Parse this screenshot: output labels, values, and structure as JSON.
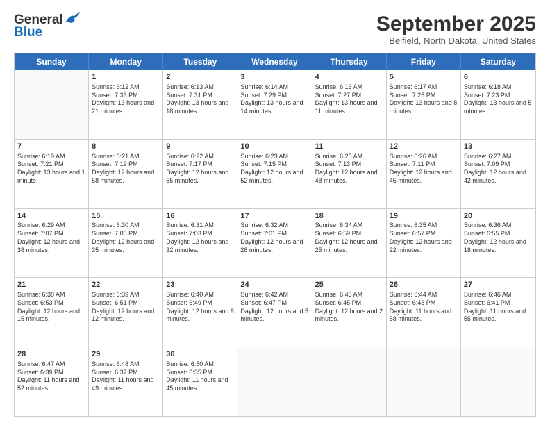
{
  "logo": {
    "general": "General",
    "blue": "Blue"
  },
  "header": {
    "month": "September 2025",
    "location": "Belfield, North Dakota, United States"
  },
  "weekdays": [
    "Sunday",
    "Monday",
    "Tuesday",
    "Wednesday",
    "Thursday",
    "Friday",
    "Saturday"
  ],
  "weeks": [
    [
      {
        "day": "",
        "sunrise": "",
        "sunset": "",
        "daylight": ""
      },
      {
        "day": "1",
        "sunrise": "Sunrise: 6:12 AM",
        "sunset": "Sunset: 7:33 PM",
        "daylight": "Daylight: 13 hours and 21 minutes."
      },
      {
        "day": "2",
        "sunrise": "Sunrise: 6:13 AM",
        "sunset": "Sunset: 7:31 PM",
        "daylight": "Daylight: 13 hours and 18 minutes."
      },
      {
        "day": "3",
        "sunrise": "Sunrise: 6:14 AM",
        "sunset": "Sunset: 7:29 PM",
        "daylight": "Daylight: 13 hours and 14 minutes."
      },
      {
        "day": "4",
        "sunrise": "Sunrise: 6:16 AM",
        "sunset": "Sunset: 7:27 PM",
        "daylight": "Daylight: 13 hours and 11 minutes."
      },
      {
        "day": "5",
        "sunrise": "Sunrise: 6:17 AM",
        "sunset": "Sunset: 7:25 PM",
        "daylight": "Daylight: 13 hours and 8 minutes."
      },
      {
        "day": "6",
        "sunrise": "Sunrise: 6:18 AM",
        "sunset": "Sunset: 7:23 PM",
        "daylight": "Daylight: 13 hours and 5 minutes."
      }
    ],
    [
      {
        "day": "7",
        "sunrise": "Sunrise: 6:19 AM",
        "sunset": "Sunset: 7:21 PM",
        "daylight": "Daylight: 13 hours and 1 minute."
      },
      {
        "day": "8",
        "sunrise": "Sunrise: 6:21 AM",
        "sunset": "Sunset: 7:19 PM",
        "daylight": "Daylight: 12 hours and 58 minutes."
      },
      {
        "day": "9",
        "sunrise": "Sunrise: 6:22 AM",
        "sunset": "Sunset: 7:17 PM",
        "daylight": "Daylight: 12 hours and 55 minutes."
      },
      {
        "day": "10",
        "sunrise": "Sunrise: 6:23 AM",
        "sunset": "Sunset: 7:15 PM",
        "daylight": "Daylight: 12 hours and 52 minutes."
      },
      {
        "day": "11",
        "sunrise": "Sunrise: 6:25 AM",
        "sunset": "Sunset: 7:13 PM",
        "daylight": "Daylight: 12 hours and 48 minutes."
      },
      {
        "day": "12",
        "sunrise": "Sunrise: 6:26 AM",
        "sunset": "Sunset: 7:11 PM",
        "daylight": "Daylight: 12 hours and 45 minutes."
      },
      {
        "day": "13",
        "sunrise": "Sunrise: 6:27 AM",
        "sunset": "Sunset: 7:09 PM",
        "daylight": "Daylight: 12 hours and 42 minutes."
      }
    ],
    [
      {
        "day": "14",
        "sunrise": "Sunrise: 6:29 AM",
        "sunset": "Sunset: 7:07 PM",
        "daylight": "Daylight: 12 hours and 38 minutes."
      },
      {
        "day": "15",
        "sunrise": "Sunrise: 6:30 AM",
        "sunset": "Sunset: 7:05 PM",
        "daylight": "Daylight: 12 hours and 35 minutes."
      },
      {
        "day": "16",
        "sunrise": "Sunrise: 6:31 AM",
        "sunset": "Sunset: 7:03 PM",
        "daylight": "Daylight: 12 hours and 32 minutes."
      },
      {
        "day": "17",
        "sunrise": "Sunrise: 6:32 AM",
        "sunset": "Sunset: 7:01 PM",
        "daylight": "Daylight: 12 hours and 28 minutes."
      },
      {
        "day": "18",
        "sunrise": "Sunrise: 6:34 AM",
        "sunset": "Sunset: 6:59 PM",
        "daylight": "Daylight: 12 hours and 25 minutes."
      },
      {
        "day": "19",
        "sunrise": "Sunrise: 6:35 AM",
        "sunset": "Sunset: 6:57 PM",
        "daylight": "Daylight: 12 hours and 22 minutes."
      },
      {
        "day": "20",
        "sunrise": "Sunrise: 6:36 AM",
        "sunset": "Sunset: 6:55 PM",
        "daylight": "Daylight: 12 hours and 18 minutes."
      }
    ],
    [
      {
        "day": "21",
        "sunrise": "Sunrise: 6:38 AM",
        "sunset": "Sunset: 6:53 PM",
        "daylight": "Daylight: 12 hours and 15 minutes."
      },
      {
        "day": "22",
        "sunrise": "Sunrise: 6:39 AM",
        "sunset": "Sunset: 6:51 PM",
        "daylight": "Daylight: 12 hours and 12 minutes."
      },
      {
        "day": "23",
        "sunrise": "Sunrise: 6:40 AM",
        "sunset": "Sunset: 6:49 PM",
        "daylight": "Daylight: 12 hours and 8 minutes."
      },
      {
        "day": "24",
        "sunrise": "Sunrise: 6:42 AM",
        "sunset": "Sunset: 6:47 PM",
        "daylight": "Daylight: 12 hours and 5 minutes."
      },
      {
        "day": "25",
        "sunrise": "Sunrise: 6:43 AM",
        "sunset": "Sunset: 6:45 PM",
        "daylight": "Daylight: 12 hours and 2 minutes."
      },
      {
        "day": "26",
        "sunrise": "Sunrise: 6:44 AM",
        "sunset": "Sunset: 6:43 PM",
        "daylight": "Daylight: 11 hours and 58 minutes."
      },
      {
        "day": "27",
        "sunrise": "Sunrise: 6:46 AM",
        "sunset": "Sunset: 6:41 PM",
        "daylight": "Daylight: 11 hours and 55 minutes."
      }
    ],
    [
      {
        "day": "28",
        "sunrise": "Sunrise: 6:47 AM",
        "sunset": "Sunset: 6:39 PM",
        "daylight": "Daylight: 11 hours and 52 minutes."
      },
      {
        "day": "29",
        "sunrise": "Sunrise: 6:48 AM",
        "sunset": "Sunset: 6:37 PM",
        "daylight": "Daylight: 11 hours and 49 minutes."
      },
      {
        "day": "30",
        "sunrise": "Sunrise: 6:50 AM",
        "sunset": "Sunset: 6:35 PM",
        "daylight": "Daylight: 11 hours and 45 minutes."
      },
      {
        "day": "",
        "sunrise": "",
        "sunset": "",
        "daylight": ""
      },
      {
        "day": "",
        "sunrise": "",
        "sunset": "",
        "daylight": ""
      },
      {
        "day": "",
        "sunrise": "",
        "sunset": "",
        "daylight": ""
      },
      {
        "day": "",
        "sunrise": "",
        "sunset": "",
        "daylight": ""
      }
    ]
  ]
}
